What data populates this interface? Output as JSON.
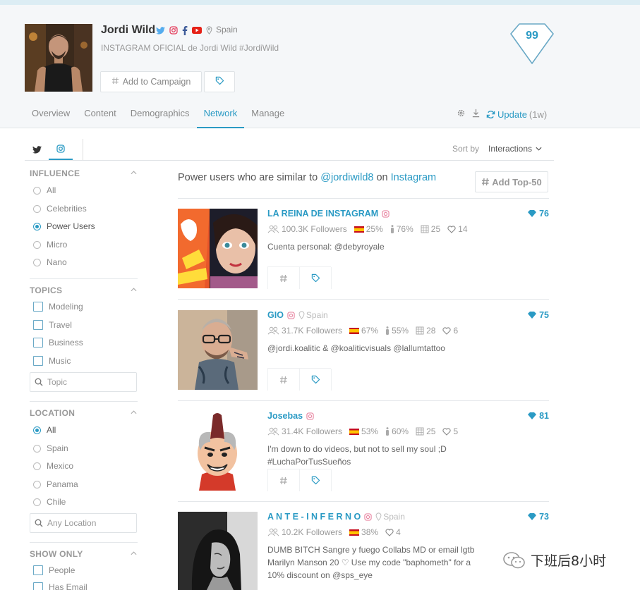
{
  "profile": {
    "name": "Jordi Wild",
    "location": "Spain",
    "bio": "INSTAGRAM OFICIAL de Jordi Wild #JordiWild",
    "score": "99",
    "add_campaign_label": "Add to Campaign"
  },
  "tabs": [
    {
      "label": "Overview",
      "active": false
    },
    {
      "label": "Content",
      "active": false
    },
    {
      "label": "Demographics",
      "active": false
    },
    {
      "label": "Network",
      "active": true
    },
    {
      "label": "Manage",
      "active": false
    }
  ],
  "update": {
    "label": "Update",
    "age": "(1w)"
  },
  "sort": {
    "label": "Sort by",
    "value": "Interactions"
  },
  "sidebar": {
    "influence": {
      "title": "INFLUENCE",
      "options": [
        {
          "label": "All",
          "selected": false
        },
        {
          "label": "Celebrities",
          "selected": false
        },
        {
          "label": "Power Users",
          "selected": true
        },
        {
          "label": "Micro",
          "selected": false
        },
        {
          "label": "Nano",
          "selected": false
        }
      ]
    },
    "topics": {
      "title": "TOPICS",
      "options": [
        {
          "label": "Modeling"
        },
        {
          "label": "Travel"
        },
        {
          "label": "Business"
        },
        {
          "label": "Music"
        }
      ],
      "placeholder": "Topic"
    },
    "location": {
      "title": "LOCATION",
      "options": [
        {
          "label": "All",
          "selected": true
        },
        {
          "label": "Spain",
          "selected": false
        },
        {
          "label": "Mexico",
          "selected": false
        },
        {
          "label": "Panama",
          "selected": false
        },
        {
          "label": "Chile",
          "selected": false
        }
      ],
      "placeholder": "Any Location"
    },
    "show_only": {
      "title": "SHOW ONLY",
      "options": [
        {
          "label": "People"
        },
        {
          "label": "Has Email"
        }
      ]
    }
  },
  "main": {
    "heading_prefix": "Power users who are similar to",
    "heading_user": "@jordiwild8",
    "heading_on": "on",
    "heading_platform": "Instagram",
    "add_top_label": "Add Top-50"
  },
  "cards": [
    {
      "name": "LA REINA DE INSTAGRAM",
      "location": "",
      "score": "76",
      "followers": "100.3K Followers",
      "country_pct": "25%",
      "gender_pct": "76%",
      "age": "25",
      "likes": "14",
      "bio": "Cuenta personal: @debyroyale"
    },
    {
      "name": "GIO",
      "location": "Spain",
      "score": "75",
      "followers": "31.7K Followers",
      "country_pct": "67%",
      "gender_pct": "55%",
      "age": "28",
      "likes": "6",
      "bio": "@jordi.koalitic & @koaliticvisuals @lallumtattoo"
    },
    {
      "name": "Josebas",
      "location": "",
      "score": "81",
      "followers": "31.4K Followers",
      "country_pct": "53%",
      "gender_pct": "60%",
      "age": "25",
      "likes": "5",
      "bio": "I'm down to do videos, but not to sell my soul ;D #LuchaPorTusSueños"
    },
    {
      "name": "A N T E - I N F E R N O",
      "location": "Spain",
      "score": "73",
      "followers": "10.2K Followers",
      "country_pct": "38%",
      "gender_pct": "",
      "age": "",
      "likes": "4",
      "bio": "DUMB BITCH Sangre y fuego Collabs MD or email lgtb Marilyn Manson 20 ♡ Use my code \"baphometh\" for a 10% discount on @sps_eye"
    }
  ],
  "watermark": {
    "text": "下班后8小时"
  },
  "colors": {
    "accent": "#2a9ac4",
    "header_bg": "#f5f7f9",
    "flag_red": "#c60b1e",
    "flag_yellow": "#ffc400"
  }
}
